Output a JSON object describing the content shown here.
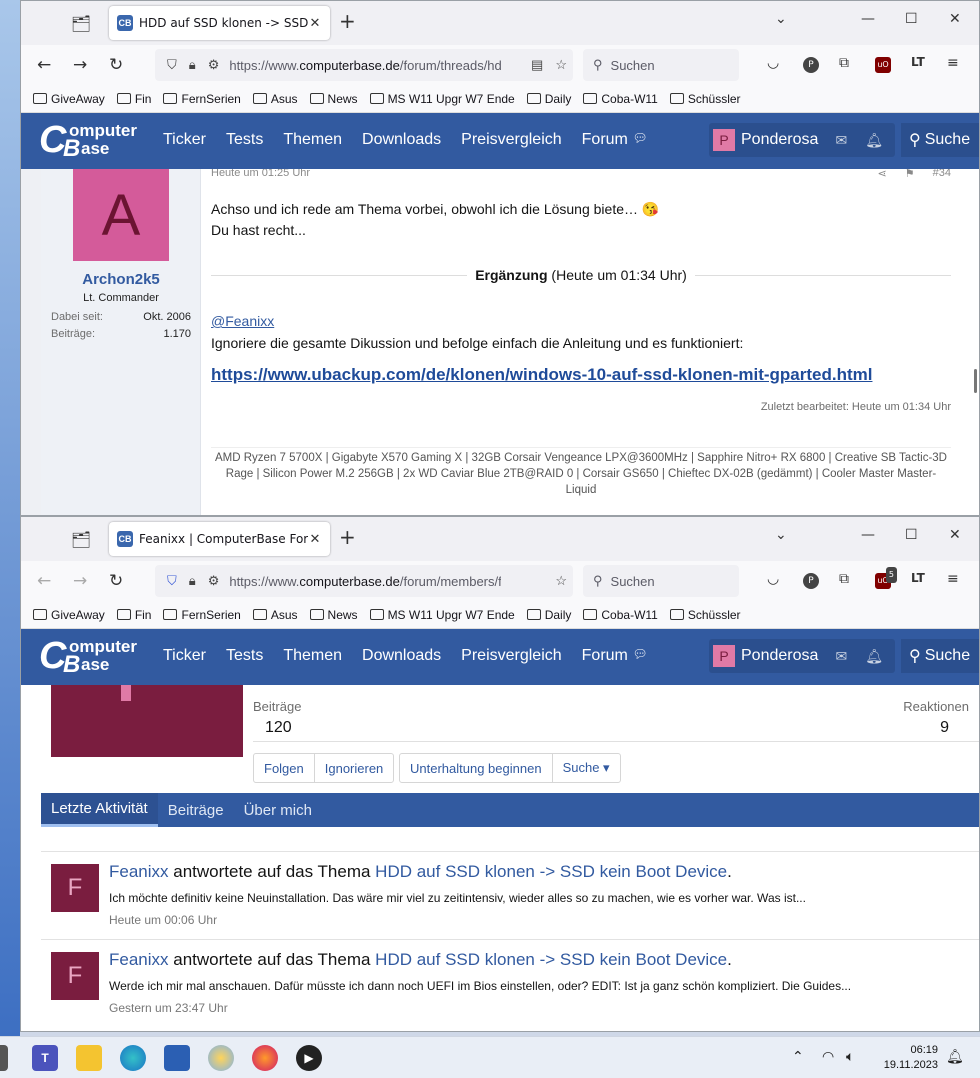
{
  "browser": {
    "bookmarks": [
      "GiveAway",
      "Fin",
      "FernSerien",
      "Asus",
      "News",
      "MS W11 Upgr W7 Ende",
      "Daily",
      "Coba-W11",
      "Schüssler"
    ],
    "search_placeholder": "Suchen",
    "ublock_badge": "5"
  },
  "site": {
    "logo_c": "C",
    "logo_b": "B",
    "logo_t1": "omputer",
    "logo_t2": "ase",
    "nav": [
      "Ticker",
      "Tests",
      "Themen",
      "Downloads",
      "Preisvergleich",
      "Forum"
    ],
    "user_initial": "P",
    "user_name": "Ponderosa",
    "search_label": "Suche"
  },
  "window1": {
    "tab_title": "HDD auf SSD klonen -> SSD kein Boot Device",
    "url_prefix": "https://www.",
    "url_domain": "computerbase.de",
    "url_path": "/forum/threads/hdd-auf-ssd-klonen",
    "post": {
      "avatar_letter": "A",
      "username": "Archon2k5",
      "user_title": "Lt. Commander",
      "joined_label": "Dabei seit:",
      "joined_value": "Okt. 2006",
      "posts_label": "Beiträge:",
      "posts_value": "1.170",
      "date": "Heute um 01:25 Uhr",
      "number": "#34",
      "line1": "Achso und ich rede am Thema vorbei, obwohl ich die Lösung biete… 😘",
      "line2": "Du hast recht...",
      "erg_bold": "Ergänzung",
      "erg_time": "(Heute um 01:34 Uhr)",
      "mention": "@Feanixx",
      "text2": "Ignoriere die gesamte Dikussion und befolge einfach die Anleitung und es funktioniert:",
      "link": "https://www.ubackup.com/de/klonen/windows-10-auf-ssd-klonen-mit-gparted.html",
      "edited": "Zuletzt bearbeitet: Heute um 01:34 Uhr",
      "signature": "AMD Ryzen 7 5700X | Gigabyte X570 Gaming X | 32GB Corsair Vengeance LPX@3600MHz | Sapphire Nitro+ RX 6800 | Creative SB Tactic-3D Rage | Silicon Power M.2 256GB | 2x WD Caviar Blue 2TB@RAID 0 | Corsair GS650 | Chieftec DX-02B (gedämmt) | Cooler Master Master-Liquid"
    }
  },
  "window2": {
    "tab_title": "Feanixx | ComputerBase Forum",
    "url_prefix": "https://www.",
    "url_domain": "computerbase.de",
    "url_path": "/forum/members/feanixx",
    "profile": {
      "posts_label": "Beiträge",
      "posts_value": "120",
      "reactions_label": "Reaktionen",
      "reactions_value": "9",
      "buttons": [
        "Folgen",
        "Ignorieren"
      ],
      "btn_conv": "Unterhaltung beginnen",
      "btn_search": "Suche ▾",
      "tabs": [
        "Letzte Aktivität",
        "Beiträge",
        "Über mich"
      ]
    },
    "activities": [
      {
        "avatar": "F",
        "user": "Feanixx",
        "verb": " antwortete auf das Thema ",
        "thread": "HDD auf SSD klonen -> SSD kein Boot Device",
        "dot": ".",
        "snippet": "Ich möchte definitiv keine Neuinstallation. Das wäre mir viel zu zeitintensiv, wieder alles so zu machen, wie es vorher war. Was ist...",
        "time": "Heute um 00:06 Uhr"
      },
      {
        "avatar": "F",
        "user": "Feanixx",
        "verb": " antwortete auf das Thema ",
        "thread": "HDD auf SSD klonen -> SSD kein Boot Device",
        "dot": ".",
        "snippet": "Werde ich mir mal anschauen. Dafür müsste ich dann noch UEFI im Bios einstellen, oder? EDIT: Ist ja ganz schön kompliziert. Die Guides...",
        "time": "Gestern um 23:47 Uhr"
      }
    ]
  },
  "taskbar": {
    "time": "06:19",
    "date": "19.11.2023"
  },
  "colors": {
    "brand": "#325aa0",
    "avatar_a": "#d45b9a",
    "avatar_f": "#7a1d3f"
  }
}
